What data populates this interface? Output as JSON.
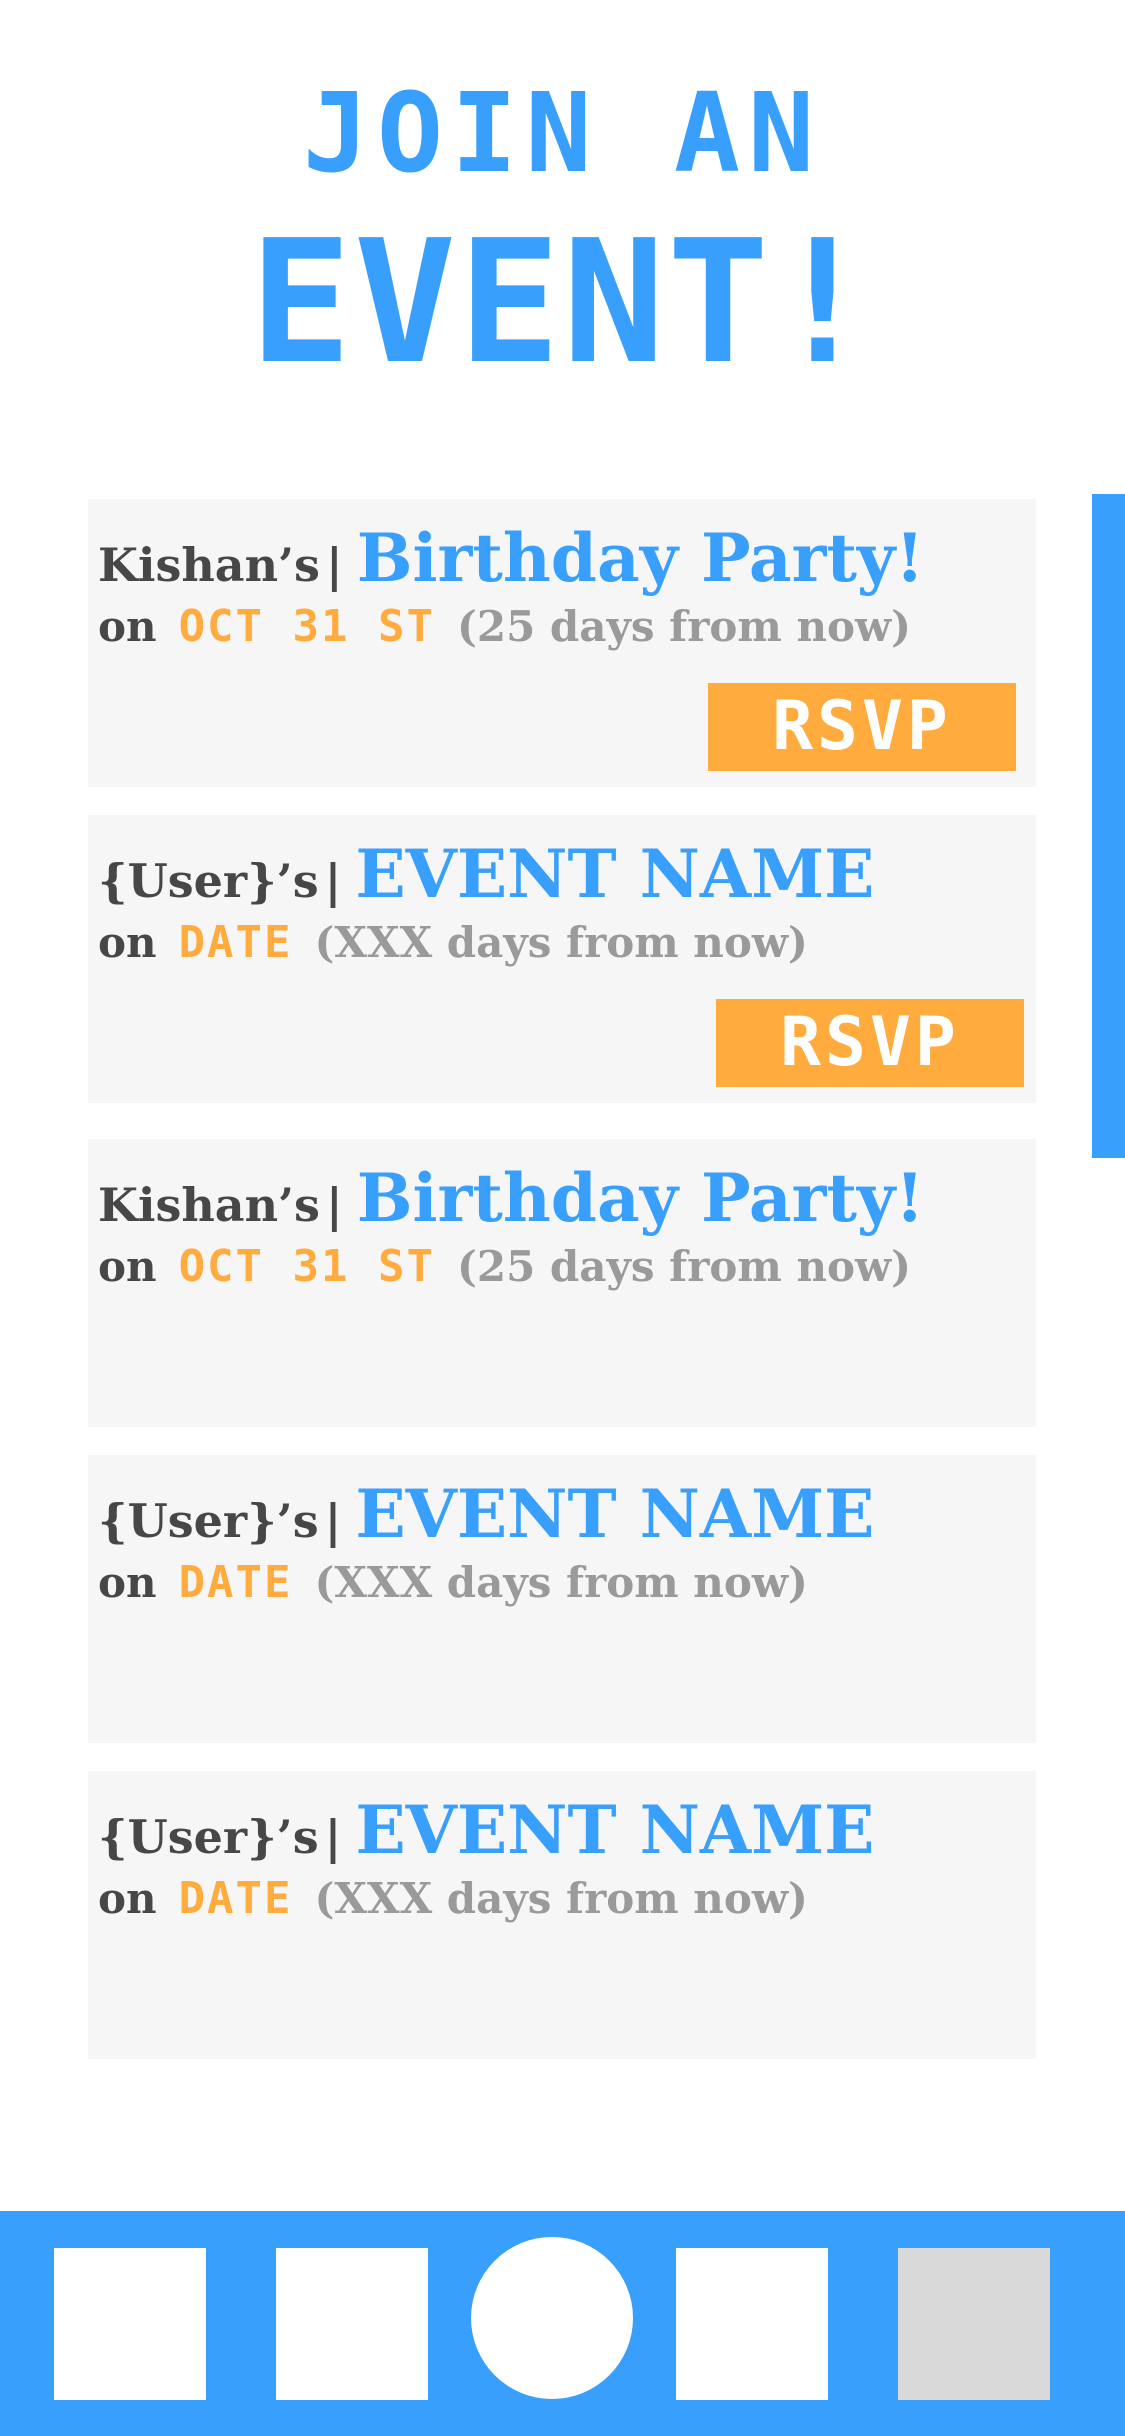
{
  "header": {
    "line1": "JOIN AN",
    "line2": "EVENT!"
  },
  "events": [
    {
      "host": "Kishan’s",
      "separator": "|",
      "name": "Birthday Party!",
      "on": "on",
      "date": "OCT 31 ST",
      "relative": "(25 days from now)",
      "rsvp_label": "RSVP"
    },
    {
      "host": "{User}’s",
      "separator": "|",
      "name": "EVENT NAME",
      "on": "on",
      "date": "DATE",
      "relative": "(XXX days from now)",
      "rsvp_label": "RSVP"
    },
    {
      "host": "Kishan’s",
      "separator": "|",
      "name": "Birthday Party!",
      "on": "on",
      "date": "OCT 31 ST",
      "relative": "(25 days from now)"
    },
    {
      "host": "{User}’s",
      "separator": "|",
      "name": "EVENT NAME",
      "on": "on",
      "date": "DATE",
      "relative": "(XXX days from now)"
    },
    {
      "host": "{User}’s",
      "separator": "|",
      "name": "EVENT NAME",
      "on": "on",
      "date": "DATE",
      "relative": "(XXX days from now)"
    }
  ],
  "colors": {
    "primary": "#399ffc",
    "accent": "#ffab3d",
    "card_bg": "#f6f6f6",
    "text_dark": "#474747",
    "text_muted": "#9a9a9a",
    "nav_inactive": "#d9d9d9"
  },
  "nav": {
    "items": [
      {
        "icon": "nav-tab-1-icon",
        "state": "default"
      },
      {
        "icon": "nav-tab-2-icon",
        "state": "default"
      },
      {
        "icon": "nav-center-circle-icon",
        "state": "default"
      },
      {
        "icon": "nav-tab-4-icon",
        "state": "default"
      },
      {
        "icon": "nav-tab-5-icon",
        "state": "inactive"
      }
    ]
  }
}
